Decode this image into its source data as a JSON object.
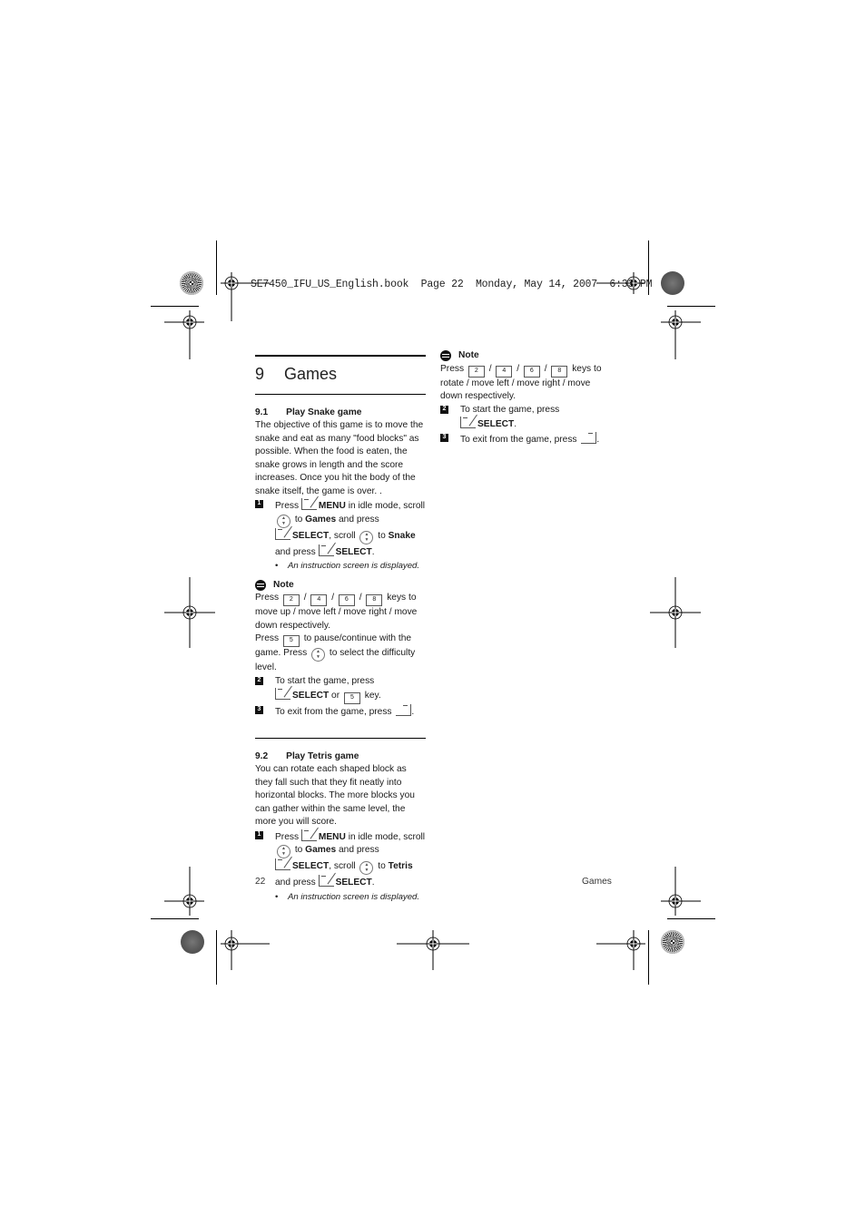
{
  "print_stamp": "SE7450_IFU_US_English.book  Page 22  Monday, May 14, 2007  6:33 PM",
  "chapter": {
    "number": "9",
    "title": "Games"
  },
  "section_1": {
    "number": "9.1",
    "title": "Play Snake game",
    "intro": "The objective of this game is to move the snake and eat as many \"food blocks\" as possible. When the food is eaten, the snake grows in length and the score increases. Once you hit the body of the snake itself, the game is over. .",
    "step1": {
      "num": "1",
      "t1": "Press ",
      "menu": "MENU",
      "t2": " in idle mode, scroll ",
      "t3": " to ",
      "games": "Games",
      "t4": " and press ",
      "select": "SELECT",
      "t5": ", scroll ",
      "t6": " to ",
      "target": "Snake",
      "t7": "and press ",
      "select2": "SELECT",
      "t8": "."
    },
    "bullet": "An instruction screen is displayed.",
    "note": {
      "title": "Note",
      "line1_a": "Press ",
      "line1_b": " keys to move up / move left / move right / move down respectively.",
      "keys": [
        "2",
        "4",
        "6",
        "8"
      ],
      "sep": " / ",
      "line2_a": "Press ",
      "key5": "5",
      "line2_b": " to pause/continue with the game. Press ",
      "line2_c": " to select the difficulty level."
    },
    "step2": {
      "num": "2",
      "t1": "To start the game, press",
      "select": "SELECT",
      "or": " or ",
      "key": "5",
      "t2": " key."
    },
    "step3": {
      "num": "3",
      "t1": "To exit from the game, press ",
      "t2": "."
    }
  },
  "section_2": {
    "number": "9.2",
    "title": "Play Tetris game",
    "intro": "You can rotate each shaped block as they fall such that they fit neatly into horizontal blocks. The more blocks you can gather within the same level, the more you will score.",
    "step1": {
      "num": "1",
      "t1": "Press ",
      "menu": "MENU",
      "t2": " in idle mode, scroll ",
      "t3": " to ",
      "games": "Games",
      "t4": " and press ",
      "select": "SELECT",
      "t5": ", scroll ",
      "t6": " to ",
      "target": "Tetris",
      "t7": "and press ",
      "select2": "SELECT",
      "t8": "."
    },
    "bullet": "An instruction screen is displayed.",
    "note": {
      "title": "Note",
      "line1_a": "Press ",
      "line1_b": " keys to rotate / move left / move right / move down respectively.",
      "keys": [
        "2",
        "4",
        "6",
        "8"
      ],
      "sep": " / "
    },
    "step2": {
      "num": "2",
      "t1": "To start the game, press",
      "select": "SELECT",
      "t2": "."
    },
    "step3": {
      "num": "3",
      "t1": "To exit from the game, press ",
      "t2": "."
    }
  },
  "footer": {
    "page_number": "22",
    "section": "Games"
  }
}
